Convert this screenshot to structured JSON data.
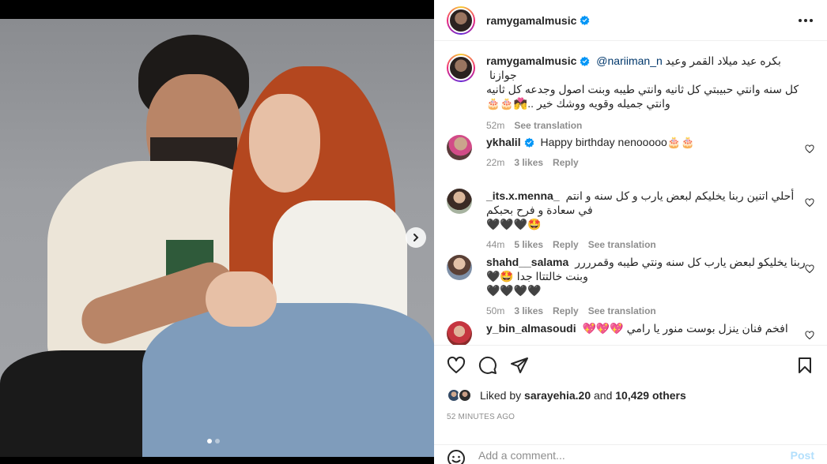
{
  "header": {
    "username": "ramygamalmusic",
    "more_label": "More options"
  },
  "caption": {
    "username": "ramygamalmusic",
    "mention": "@nariiman_n",
    "text_line1": "بكره عيد ميلاد القمر وعيد جوازنا",
    "text_line2": "كل سنه وانتي حبيبتي كل ثانيه وانتي طيبه وبنت اصول وجدعه كل ثانيه",
    "text_line3": "وانتي جميله وقويه ووشك خير ..💏🎂🎂",
    "time": "52m",
    "see_translation": "See translation"
  },
  "comments": [
    {
      "username": "ykhalil",
      "verified": true,
      "text": "Happy birthday nenooooo🎂🎂",
      "time": "22m",
      "likes": "3 likes",
      "reply": "Reply",
      "translation": ""
    },
    {
      "username": "_its.x.menna_",
      "verified": false,
      "text": "أحلي اتنين ربنا يخليكم لبعض يارب و كل سنه و انتم",
      "text2": "في سعادة و فرح بحبكم 🤩🖤🖤🖤",
      "time": "44m",
      "likes": "5 likes",
      "reply": "Reply",
      "translation": "See translation"
    },
    {
      "username": "shahd__salama",
      "verified": false,
      "text": "ربنا يخليكو لبعض يارب كل سنه ونتي طيبه وقمرررر",
      "text2": "وبنت خالتتاا جدا 🤩🖤🖤🖤🖤🖤",
      "time": "50m",
      "likes": "3 likes",
      "reply": "Reply",
      "translation": "See translation"
    },
    {
      "username": "y_bin_almasoudi",
      "verified": false,
      "text": "افخم فنان ينزل بوست منور يا رامي 💖💖💖",
      "time": "",
      "likes": "",
      "reply": "",
      "translation": ""
    }
  ],
  "likes": {
    "prefix": "Liked by",
    "user": "sarayehia.20",
    "connector": "and",
    "count": "10,429 others"
  },
  "timestamp": "52 MINUTES AGO",
  "add_comment": {
    "placeholder": "Add a comment...",
    "post_label": "Post"
  },
  "carousel": {
    "current": 1,
    "total": 2
  },
  "colors": {
    "verified": "#0095f6",
    "link": "#00376b",
    "muted": "#8e8e8e",
    "post_disabled": "#b2dffc"
  }
}
